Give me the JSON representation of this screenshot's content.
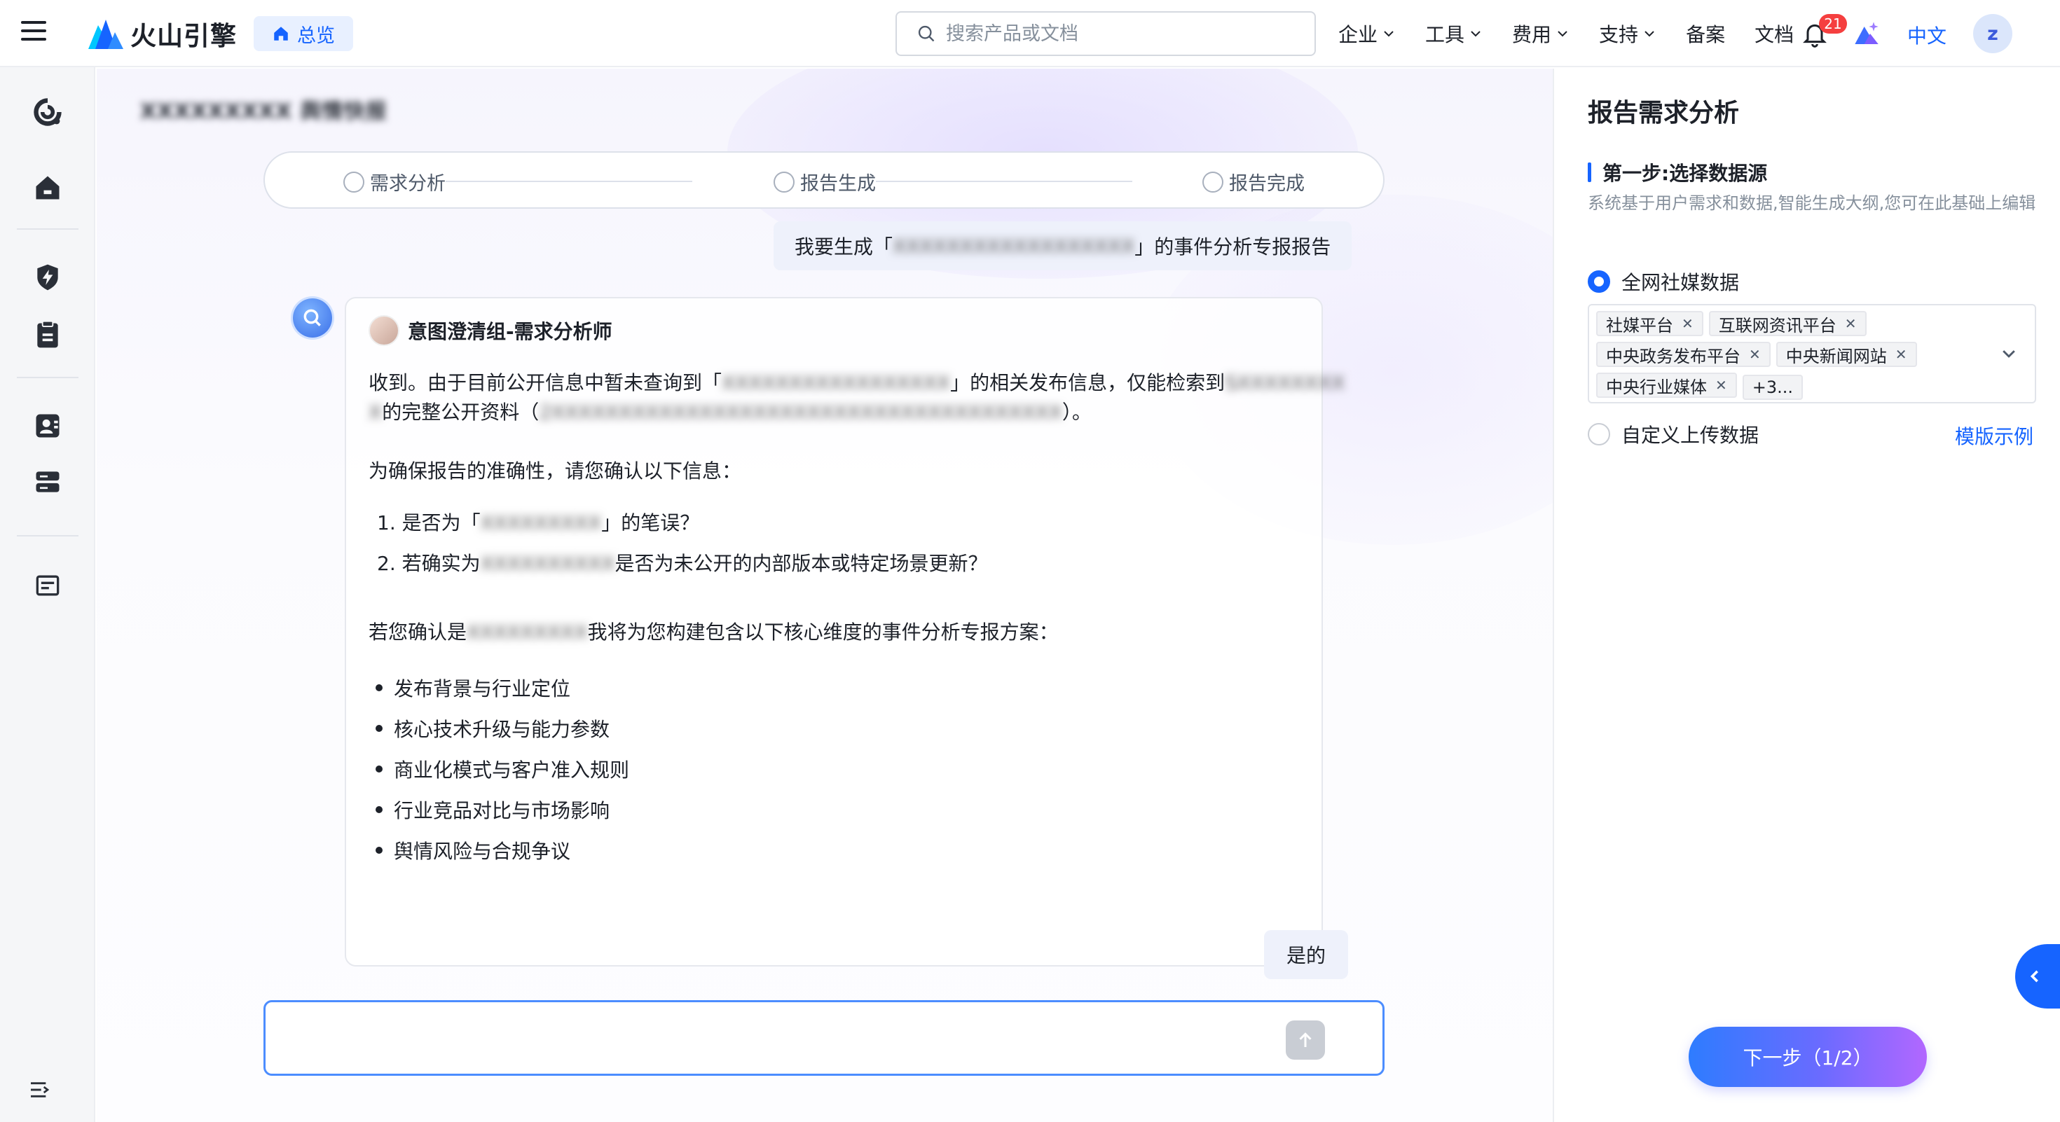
{
  "brand": {
    "name": "火山引擎"
  },
  "header": {
    "home_label": "总览",
    "search_placeholder": "搜索产品或文档",
    "nav": [
      {
        "label": "企业",
        "dropdown": true
      },
      {
        "label": "工具",
        "dropdown": true
      },
      {
        "label": "费用",
        "dropdown": true
      },
      {
        "label": "支持",
        "dropdown": true
      },
      {
        "label": "备案",
        "dropdown": false
      },
      {
        "label": "文档",
        "dropdown": false
      }
    ],
    "notification_count": "21",
    "language": "中文",
    "user_initial": "z"
  },
  "main": {
    "page_title": "XXXXXXXXX 舆情快报",
    "steps": [
      {
        "label": "需求分析"
      },
      {
        "label": "报告生成"
      },
      {
        "label": "报告完成"
      }
    ],
    "user_message": {
      "prefix": "我要生成「",
      "redacted": "XXXXXXXXXXXXXXXXXX",
      "suffix": "」的事件分析专报报告"
    },
    "bot": {
      "agent_name": "意图澄清组-需求分析师",
      "line1_a": "收到。由于目前公开信息中暂未查询到「",
      "line1_red": "XXXXXXXXXXXXXXXXX",
      "line1_b": "」的相关发布信息，仅能检索到",
      "line1_red2": "SXXXXXXXX",
      "line2_red": "X",
      "line2_a": "的完整公开资料（",
      "line2_red2": "2XXXXXXXXXXXXXXXXXXXXXXXXXXXXXXXXXXXXXX",
      "line2_b": "）。",
      "confirm_intro": "为确保报告的准确性，请您确认以下信息：",
      "q1_a": "1. 是否为「",
      "q1_red": "XXXXXXXXX",
      "q1_b": "」的笔误？",
      "q2_a": "2. 若确实为",
      "q2_red": "XXXXXXXXXX",
      "q2_b": "是否为未公开的内部版本或特定场景更新？",
      "plan_a": "若您确认是",
      "plan_red": "XXXXXXXXX",
      "plan_b": "我将为您构建包含以下核心维度的事件分析专报方案：",
      "bullets": [
        "发布背景与行业定位",
        "核心技术升级与能力参数",
        "商业化模式与客户准入规则",
        "行业竞品对比与市场影响",
        "舆情风险与合规争议"
      ]
    },
    "reply": "是的",
    "composer_placeholder": ""
  },
  "panel": {
    "title": "报告需求分析",
    "step_title": "第一步:选择数据源",
    "step_desc": "系统基于用户需求和数据,智能生成大纲,您可在此基础上编辑",
    "option_all": "全网社媒数据",
    "tags": [
      "社媒平台",
      "互联网资讯平台",
      "中央政务发布平台",
      "中央新闻网站",
      "中央行业媒体"
    ],
    "more_tags": "+3...",
    "option_custom": "自定义上传数据",
    "example_link": "模版示例",
    "next_button": "下一步（1/2）"
  },
  "colors": {
    "accent": "#1664ff",
    "badge": "#f53f3f"
  }
}
